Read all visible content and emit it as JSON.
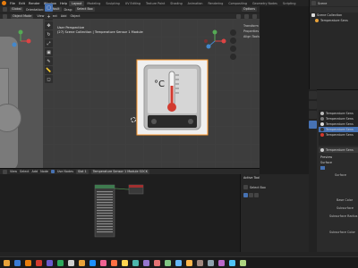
{
  "menubar": {
    "items": [
      "File",
      "Edit",
      "Render",
      "Window",
      "Help"
    ],
    "workspaces": [
      "Layout",
      "Modeling",
      "Sculpting",
      "UV Editing",
      "Texture Paint",
      "Shading",
      "Animation",
      "Rendering",
      "Compositing",
      "Geometry Nodes",
      "Scripting"
    ],
    "scene_label": "Scene"
  },
  "viewport_header": {
    "mode": "Object Mode",
    "menus": [
      "View",
      "Select",
      "Add",
      "Object"
    ],
    "transform": "Global",
    "orientation_label": "Orientation:",
    "orientation_value": "Default",
    "drag_label": "Drag:",
    "drag_value": "Select Box",
    "options": "Options"
  },
  "viewport": {
    "line1": "User Perspective",
    "line2": "(27) Scene Collection | Temperature Sensor 1 Module",
    "npanel_items": [
      "Transform",
      "Properties",
      "Align Tools"
    ],
    "thermo_symbol": "°C"
  },
  "midbar": {
    "menus": [
      "View",
      "Select",
      "Add",
      "Node"
    ],
    "use_nodes": "Use Nodes",
    "slot": "Slot 1",
    "material": "Temperature Sensor 1 Module SOCK"
  },
  "nodepanel": {
    "title": "Active Tool",
    "select_box": "Select Box"
  },
  "outliner": {
    "title": "Scene Collection",
    "items": [
      "Temperature Sens"
    ]
  },
  "properties": {
    "materials": [
      "Temperature Sens",
      "Temperature Sens",
      "Temperature Sens",
      "Temperature Sens",
      "Temperature Sens"
    ],
    "active_material": "Temperature Sens",
    "sections": [
      "Preview",
      "Surface"
    ],
    "surface": "Surface",
    "fields": [
      "Base Color",
      "Subsurface",
      "Subsurface Radius",
      "Subsurface Color"
    ]
  },
  "colors": {
    "accent": "#4772b3",
    "blender_orange": "#e87d0d",
    "thermo_red": "#d23a2f"
  }
}
